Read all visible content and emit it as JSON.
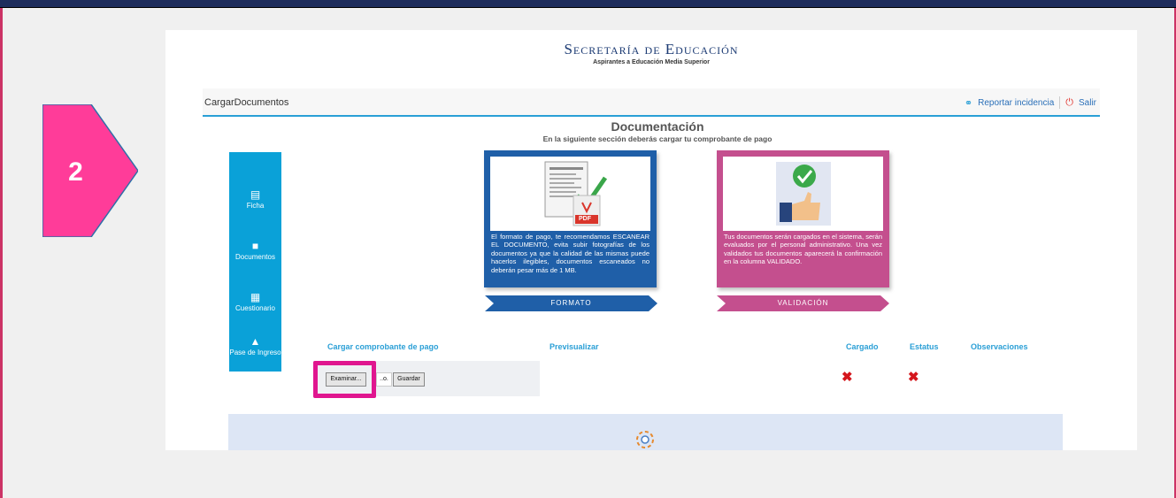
{
  "step": {
    "number": "2"
  },
  "brand": {
    "title": "Secretaría de Educación",
    "subtitle": "Aspirantes a Educación Media Superior"
  },
  "navbar": {
    "title": "CargarDocumentos",
    "report_label": "Reportar incidencia",
    "exit_label": "Salir"
  },
  "section": {
    "title": "Documentación",
    "subtitle": "En la siguiente sección deberás cargar tu comprobante de pago"
  },
  "sidebar": {
    "items": [
      {
        "label": "Ficha",
        "icon": "id-card-icon"
      },
      {
        "label": "Documentos",
        "icon": "folder-icon"
      },
      {
        "label": "Cuestionario",
        "icon": "form-icon"
      },
      {
        "label": "Pase de Ingreso",
        "icon": "upload-icon"
      }
    ]
  },
  "cards": {
    "format": {
      "text": "El formato de pago, te recomendamos ESCANEAR EL DOCUMENTO, evita subir fotografías de los documentos ya que la calidad de las mismas puede hacerlos ilegibles, documentos escaneados no deberán pesar más de 1 MB.",
      "label": "FORMATO",
      "badge": "PDF"
    },
    "validation": {
      "text": "Tus documentos serán cargados en el sistema, serán evaluados por el personal administrativo. Una vez validados tus documentos aparecerá la confirmación en la columna VALIDADO.",
      "label": "VALIDACIÓN"
    }
  },
  "table": {
    "headers": [
      "Cargar comprobante de pago",
      "Previsualizar",
      "Cargado",
      "Estatus",
      "Observaciones"
    ],
    "browse_label": "Examinar...",
    "file_label": "..o.",
    "save_label": "Guardar",
    "cargado": "✖",
    "estatus": "✖"
  },
  "colors": {
    "accent": "#2a9fd6",
    "brand": "#1b3a73",
    "highlight": "#e0168f",
    "card_blue": "#1f5fa8",
    "card_pink": "#c44f8e"
  }
}
